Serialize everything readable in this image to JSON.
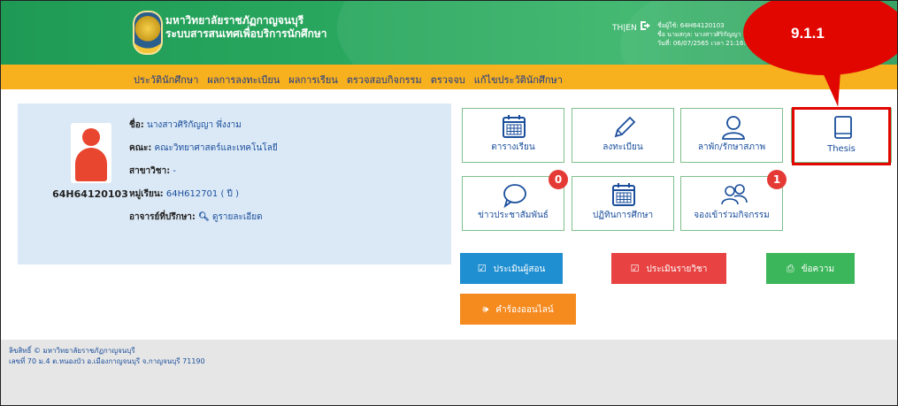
{
  "header": {
    "title_line1": "มหาวิทยาลัยราชภัฏกาญจนบุรี",
    "title_line2": "ระบบสารสนเทศเพื่อบริการนักศึกษา",
    "lang": "TH|EN",
    "user_line1": "ชื่อผู้ใช้: 64H64120103",
    "user_line2": "ชื่อ นามสกุล: นางสาวศิริกัญญา พ",
    "user_line3": "วันที่: 06/07/2565 เวลา 21:16:0"
  },
  "menu": [
    "ประวัตินักศึกษา",
    "ผลการลงทะเบียน",
    "ผลการเรียน",
    "ตรวจสอบกิจกรรม",
    "ตรวจจบ",
    "แก้ไขประวัตินักศึกษา"
  ],
  "profile": {
    "student_id": "64H64120103",
    "name_label": "ชื่อ:",
    "name_value": "นางสาวศิริกัญญา พึ่งงาม",
    "faculty_label": "คณะ:",
    "faculty_value": "คณะวิทยาศาสตร์และเทคโนโลยี",
    "major_label": "สาขาวิชา:",
    "major_value": "-",
    "group_label": "หมู่เรียน:",
    "group_value": "64H612701 ( ปี )",
    "advisor_label": "อาจารย์ที่ปรึกษา:",
    "advisor_value": "ดูรายละเอียด"
  },
  "tiles": {
    "schedule": "ตารางเรียน",
    "register": "ลงทะเบียน",
    "leave": "ลาพัก/รักษาสภาพ",
    "thesis": "Thesis",
    "news": "ข่าวประชาสัมพันธ์",
    "calendar": "ปฏิทินการศึกษา",
    "activity": "จองเข้าร่วมกิจกรรม"
  },
  "badges": {
    "news": "0",
    "activity": "1"
  },
  "buttons": {
    "eval_teacher": "ประเมินผู้สอน",
    "eval_course": "ประเมินรายวิชา",
    "message": "ข้อความ",
    "complaint": "คำร้องออนไลน์"
  },
  "footer": {
    "line1": "ลิขสิทธิ์ © มหาวิทยาลัยราชภัฏกาญจนบุรี",
    "line2": "เลขที่ 70 ม.4 ต.หนองบัว อ.เมืองกาญจนบุรี จ.กาญจนบุรี 71190"
  },
  "annotation": "9.1.1",
  "colors": {
    "header_green": "#2aa85f",
    "menu_orange": "#f7b01e",
    "eval_blue": "#1f8fd1",
    "eval_red": "#e84242",
    "message_green": "#3cb65a",
    "complaint_orange": "#f58a1f",
    "badge_red": "#e53935",
    "callout_red": "#e10600"
  }
}
